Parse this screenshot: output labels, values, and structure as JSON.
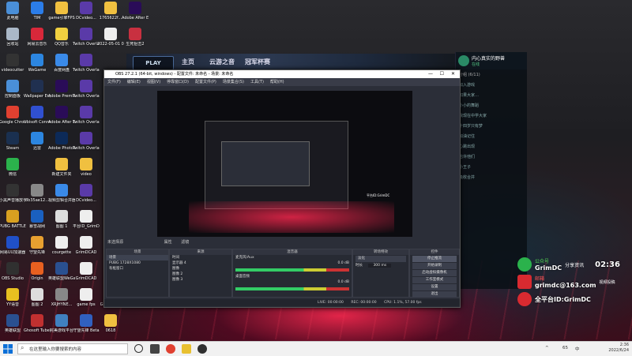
{
  "desktop_icons": [
    {
      "label": "此电脑",
      "color": "#4a8fd8",
      "col": 0,
      "row": 0
    },
    {
      "label": "TIM",
      "color": "#2b7de9",
      "col": 1,
      "row": 0
    },
    {
      "label": "game引擎FPS",
      "color": "#f0c040",
      "col": 2,
      "row": 0
    },
    {
      "label": "DCvideo...",
      "color": "#5a3aa8",
      "col": 3,
      "row": 0
    },
    {
      "label": "1765622f...",
      "color": "#f0c040",
      "col": 4,
      "row": 0
    },
    {
      "label": "Adobe After Effects 2...",
      "color": "#2a0c58",
      "col": 5,
      "row": 0
    },
    {
      "label": "回收站",
      "color": "#aab8c8",
      "col": 0,
      "row": 1
    },
    {
      "label": "网易云音乐",
      "color": "#d8283a",
      "col": 1,
      "row": 1
    },
    {
      "label": "QQ音乐",
      "color": "#f0d040",
      "col": 2,
      "row": 1
    },
    {
      "label": "Twitch Overlay...",
      "color": "#5a3aa8",
      "col": 3,
      "row": 1
    },
    {
      "label": "2022-05-01 05-19-26.0...",
      "color": "#eeeeee",
      "col": 4,
      "row": 1
    },
    {
      "label": "生死狙击2",
      "color": "#c83040",
      "col": 5,
      "row": 1
    },
    {
      "label": "videocutter",
      "color": "#333333",
      "col": 0,
      "row": 2
    },
    {
      "label": "WeGame",
      "color": "#2c86e0",
      "col": 1,
      "row": 2
    },
    {
      "label": "百度网盘",
      "color": "#3a8ae8",
      "col": 2,
      "row": 2
    },
    {
      "label": "Twitch Overlay...",
      "color": "#5a3aa8",
      "col": 3,
      "row": 2
    },
    {
      "label": "控制面板",
      "color": "#4a8fd8",
      "col": 0,
      "row": 3
    },
    {
      "label": "Wallpaper Engine:...",
      "color": "#203050",
      "col": 1,
      "row": 3
    },
    {
      "label": "Adobe Premie...",
      "color": "#2a0c58",
      "col": 2,
      "row": 3
    },
    {
      "label": "Twitch Overlay...",
      "color": "#5a3aa8",
      "col": 3,
      "row": 3
    },
    {
      "label": "Google Chrome",
      "color": "#e04030",
      "col": 0,
      "row": 4
    },
    {
      "label": "Ubisoft Connect",
      "color": "#3050d0",
      "col": 1,
      "row": 4
    },
    {
      "label": "Adobe After Effects 2022",
      "color": "#2a0c58",
      "col": 2,
      "row": 4
    },
    {
      "label": "Twitch Overlay...",
      "color": "#5a3aa8",
      "col": 3,
      "row": 4
    },
    {
      "label": "Steam",
      "color": "#1a3050",
      "col": 0,
      "row": 5
    },
    {
      "label": "迅雷",
      "color": "#2c86e0",
      "col": 1,
      "row": 5
    },
    {
      "label": "Adobe Photosh...",
      "color": "#0c2a58",
      "col": 2,
      "row": 5
    },
    {
      "label": "Twitch Overlay...",
      "color": "#5a3aa8",
      "col": 3,
      "row": 5
    },
    {
      "label": "微信",
      "color": "#2bb24c",
      "col": 0,
      "row": 6
    },
    {
      "label": "新建文件夹",
      "color": "#f0c040",
      "col": 2,
      "row": 6
    },
    {
      "label": "video",
      "color": "#f0c040",
      "col": 3,
      "row": 6
    },
    {
      "label": "小黑声音播放手",
      "color": "#333333",
      "col": 0,
      "row": 7
    },
    {
      "label": "8b35ae12...",
      "color": "#888888",
      "col": 1,
      "row": 7
    },
    {
      "label": "视频剪辑合并器",
      "color": "#3a8ae8",
      "col": 2,
      "row": 7
    },
    {
      "label": "DCvideo...",
      "color": "#5a3aa8",
      "col": 3,
      "row": 7
    },
    {
      "label": "PUBG BATTLEGR...",
      "color": "#d8a020",
      "col": 0,
      "row": 8
    },
    {
      "label": "暴雪战网",
      "color": "#1a60c0",
      "col": 1,
      "row": 8
    },
    {
      "label": "图图 1",
      "color": "#dddddd",
      "col": 2,
      "row": 8
    },
    {
      "label": "平台ID_GrimDC",
      "color": "#eeeeee",
      "col": 3,
      "row": 8
    },
    {
      "label": "网易UU加速器",
      "color": "#2050c8",
      "col": 0,
      "row": 9
    },
    {
      "label": "守望先锋",
      "color": "#e8a030",
      "col": 1,
      "row": 9
    },
    {
      "label": "courgette",
      "color": "#eeeeee",
      "col": 2,
      "row": 9
    },
    {
      "label": "GrimDCAD",
      "color": "#eeeeee",
      "col": 3,
      "row": 9
    },
    {
      "label": "OBS Studio",
      "color": "#303030",
      "col": 0,
      "row": 10
    },
    {
      "label": "Origin",
      "color": "#e86020",
      "col": 1,
      "row": 10
    },
    {
      "label": "英雄联盟WeGame版",
      "color": "#2a5090",
      "col": 2,
      "row": 10
    },
    {
      "label": "GrimDCAD",
      "color": "#eeeeee",
      "col": 3,
      "row": 10
    },
    {
      "label": "YY语音",
      "color": "#e8c020",
      "col": 0,
      "row": 11
    },
    {
      "label": "图图 2",
      "color": "#dddddd",
      "col": 1,
      "row": 11
    },
    {
      "label": "XRJHYNE...",
      "color": "#888888",
      "col": 2,
      "row": 11
    },
    {
      "label": "game fps",
      "color": "#eeeeee",
      "col": 3,
      "row": 11
    },
    {
      "label": "GrimDCAD",
      "color": "#eeeeee",
      "col": 4,
      "row": 11
    },
    {
      "label": "英雄联盟",
      "color": "#2a5090",
      "col": 0,
      "row": 12
    },
    {
      "label": "Ghosoft TubeGet",
      "color": "#c03030",
      "col": 1,
      "row": 12
    },
    {
      "label": "完美游戏平台",
      "color": "#4080c0",
      "col": 2,
      "row": 12
    },
    {
      "label": "守望先锋 Beta",
      "color": "#3060c0",
      "col": 3,
      "row": 12
    },
    {
      "label": "0618",
      "color": "#f0c040",
      "col": 4,
      "row": 12
    }
  ],
  "banner": {
    "play": "PLAY",
    "nav1": "主页",
    "nav2": "云游之音",
    "nav3": "冠军杯赛"
  },
  "chat": {
    "name": "内心真实的野兽",
    "status": "在线",
    "count": "分组 (6/11)",
    "messages": [
      "加入游戏",
      "如果大家…",
      "小小的舞蹈",
      "我现在中学大家",
      "十四岁只有梦",
      "加油记住",
      "心跳出现",
      "也许他们",
      "小王子",
      "吸收合并"
    ]
  },
  "obs": {
    "title": "OBS 27.2.1 (64-bit, windows) - 配置文件: 未命名 - 场景: 未命名",
    "menu": [
      "文件(F)",
      "编辑(E)",
      "视图(V)",
      "停靠窗口(D)",
      "配置文件(P)",
      "场景集合(S)",
      "工具(T)",
      "帮助(H)"
    ],
    "preview_watermark": "平台ID:GrimDC",
    "tabs": [
      "未选择源",
      "属性",
      "滤镜"
    ],
    "scenes": {
      "title": "场景",
      "items": [
        "场景",
        "PUBG 1728X1080",
        "有框窗口"
      ]
    },
    "sources": {
      "title": "来源",
      "items": [
        "时间",
        "显示器 4",
        "图像",
        "图像 2",
        "图像 3"
      ]
    },
    "mixer": {
      "title": "混音器",
      "channels": [
        {
          "name": "麦克风/Aux",
          "db": "0.0 dB"
        },
        {
          "name": "桌面音频",
          "db": "0.0 dB"
        }
      ]
    },
    "transitions": {
      "title": "转场特效",
      "mode": "淡化",
      "duration_label": "时长",
      "duration": "300 ms"
    },
    "controls": {
      "title": "控件",
      "buttons": [
        "停止推流",
        "开始录制",
        "启动虚拟摄像机",
        "工作室模式",
        "设置",
        "退出"
      ]
    },
    "status": {
      "live": "LIVE: 00:00:00",
      "rec": "REC: 00:00:00",
      "cpu": "CPU: 1.1%, 57.00 fps"
    }
  },
  "overlay": {
    "wechat_label": "公众号",
    "wechat_name": "GrimDC",
    "wechat_tag": "分享资讯",
    "timer": "02:36",
    "mail_label": "邮箱",
    "mail": "grimdc@163.com",
    "mail_tag": "视频投稿",
    "platform": "全平台ID:GrimDC"
  },
  "taskbar": {
    "search_placeholder": "在这里输入你要搜索的内容",
    "time": "2:36",
    "date": "2022/6/24",
    "ime": "中",
    "tray_num": "65"
  }
}
